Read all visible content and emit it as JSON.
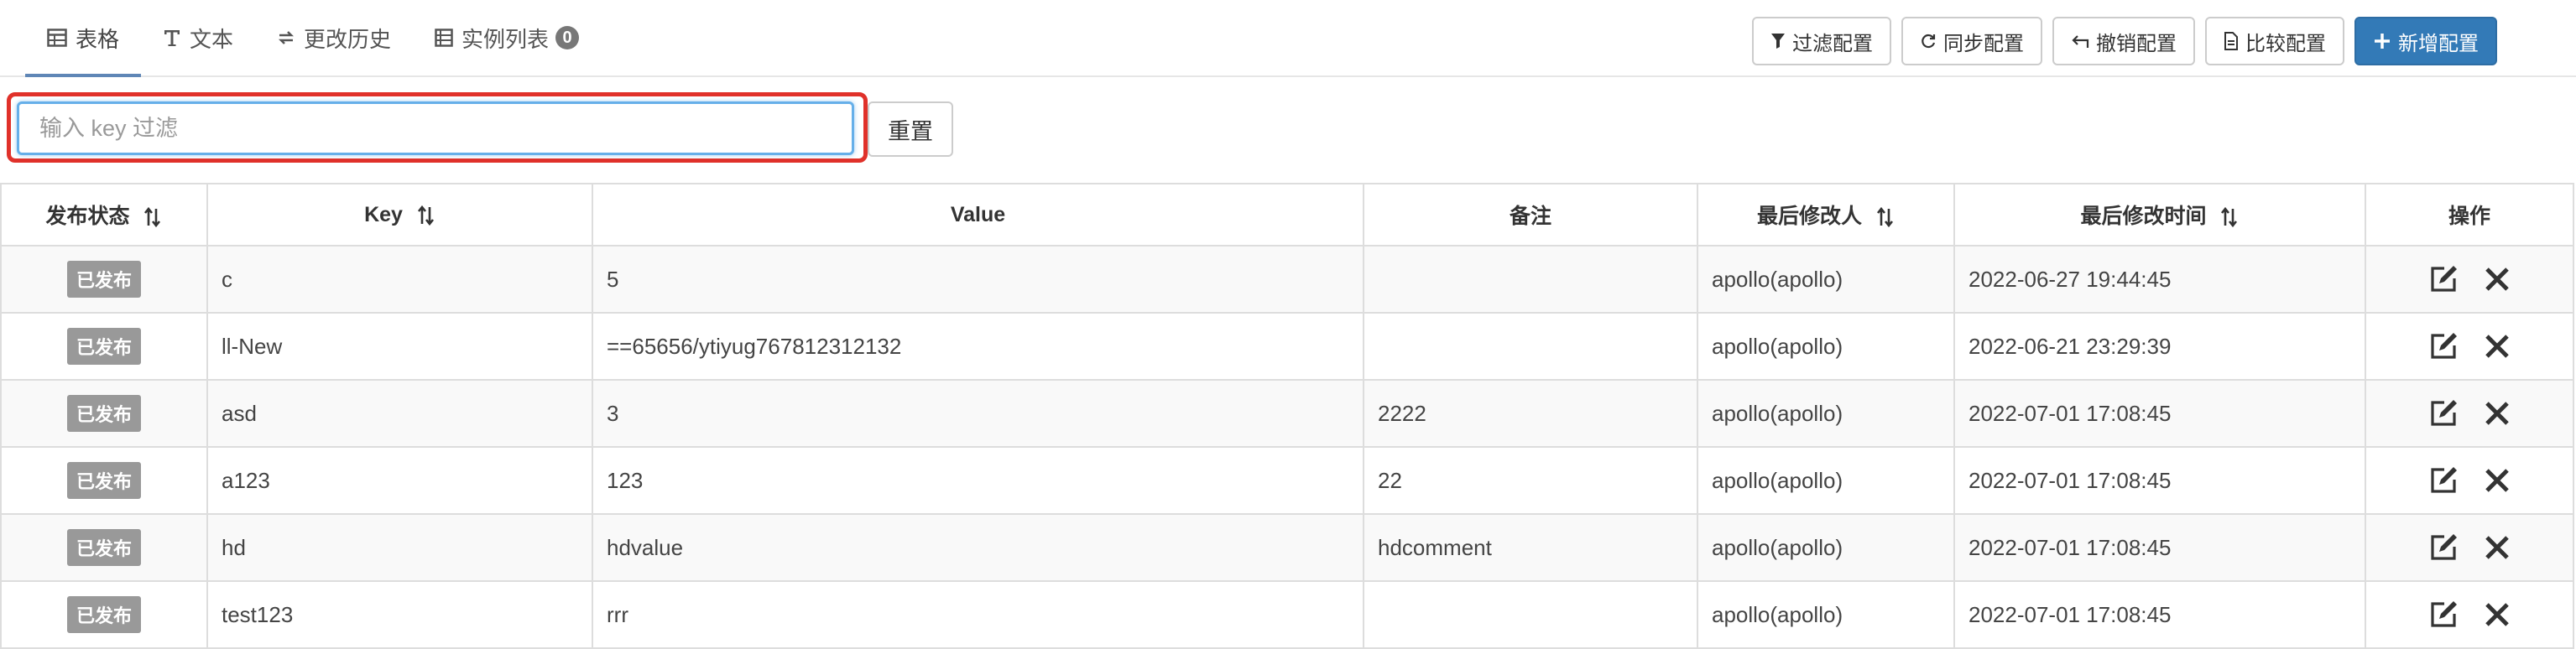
{
  "tabs": [
    {
      "label": "表格",
      "icon": "table-icon",
      "active": true
    },
    {
      "label": "文本",
      "icon": "text-icon"
    },
    {
      "label": "更改历史",
      "icon": "history-icon"
    },
    {
      "label": "实例列表",
      "icon": "instance-list-icon",
      "badge": "0"
    }
  ],
  "toolbar": {
    "filter": "过滤配置",
    "sync": "同步配置",
    "revoke": "撤销配置",
    "compare": "比较配置",
    "add": "新增配置"
  },
  "filter": {
    "placeholder": "输入 key 过滤",
    "value": "",
    "reset": "重置"
  },
  "table": {
    "headers": {
      "status": "发布状态",
      "key": "Key",
      "value": "Value",
      "comment": "备注",
      "modifier": "最后修改人",
      "time": "最后修改时间",
      "ops": "操作"
    },
    "rows": [
      {
        "status": "已发布",
        "key": "c",
        "value": "5",
        "comment": "",
        "modifier": "apollo(apollo)",
        "time": "2022-06-27 19:44:45"
      },
      {
        "status": "已发布",
        "key": "ll-New",
        "value": "==65656/ytiyug767812312132",
        "comment": "",
        "modifier": "apollo(apollo)",
        "time": "2022-06-21 23:29:39"
      },
      {
        "status": "已发布",
        "key": "asd",
        "value": "3",
        "comment": "2222",
        "modifier": "apollo(apollo)",
        "time": "2022-07-01 17:08:45"
      },
      {
        "status": "已发布",
        "key": "a123",
        "value": "123",
        "comment": "22",
        "modifier": "apollo(apollo)",
        "time": "2022-07-01 17:08:45"
      },
      {
        "status": "已发布",
        "key": "hd",
        "value": "hdvalue",
        "comment": "hdcomment",
        "modifier": "apollo(apollo)",
        "time": "2022-07-01 17:08:45"
      },
      {
        "status": "已发布",
        "key": "test123",
        "value": "rrr",
        "comment": "",
        "modifier": "apollo(apollo)",
        "time": "2022-07-01 17:08:45"
      }
    ]
  },
  "colors": {
    "primary": "#337ab7",
    "highlight": "#e0312a",
    "tab_underline": "#5f86b6",
    "status_badge": "#999999"
  }
}
